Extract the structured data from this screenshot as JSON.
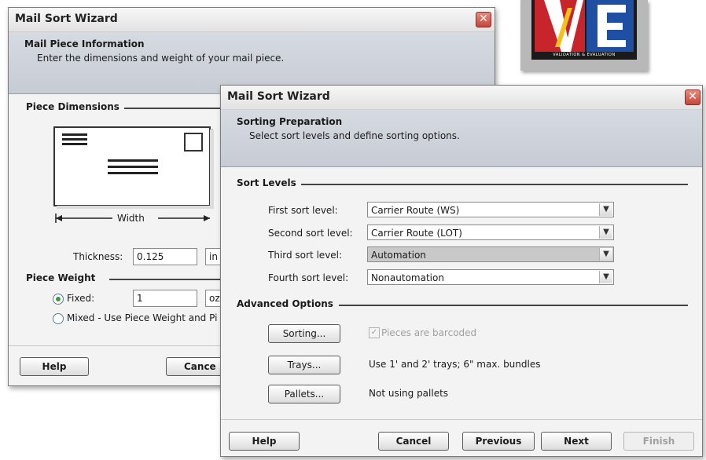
{
  "logo": {
    "letters": "VE",
    "tagline": "VALIDATION & EVALUATION"
  },
  "back_dialog": {
    "title": "Mail Sort Wizard",
    "header_title": "Mail Piece Information",
    "header_subtitle": "Enter the dimensions and weight of your mail piece.",
    "section_dimensions": "Piece Dimensions",
    "width_label": "Width",
    "thickness_label": "Thickness:",
    "thickness_value": "0.125",
    "thickness_unit": "in",
    "section_weight": "Piece Weight",
    "fixed_label": "Fixed:",
    "fixed_value": "1",
    "fixed_unit": "oz",
    "mixed_label": "Mixed - Use Piece Weight and Pi",
    "help_button": "Help",
    "cancel_button": "Cance"
  },
  "front_dialog": {
    "title": "Mail Sort Wizard",
    "header_title": "Sorting Preparation",
    "header_subtitle": "Select sort levels and define sorting options.",
    "section_sort_levels": "Sort Levels",
    "sort_levels": [
      {
        "label": "First sort level:",
        "value": "Carrier Route (WS)"
      },
      {
        "label": "Second sort level:",
        "value": "Carrier Route (LOT)"
      },
      {
        "label": "Third sort level:",
        "value": "Automation"
      },
      {
        "label": "Fourth sort level:",
        "value": "Nonautomation"
      }
    ],
    "section_advanced": "Advanced Options",
    "sorting_button": "Sorting...",
    "barcoded_label": "Pieces are barcoded",
    "trays_button": "Trays...",
    "trays_desc": "Use 1' and 2' trays; 6\" max. bundles",
    "pallets_button": "Pallets...",
    "pallets_desc": "Not using pallets",
    "help_button": "Help",
    "cancel_button": "Cancel",
    "previous_button": "Previous",
    "next_button": "Next",
    "finish_button": "Finish"
  }
}
